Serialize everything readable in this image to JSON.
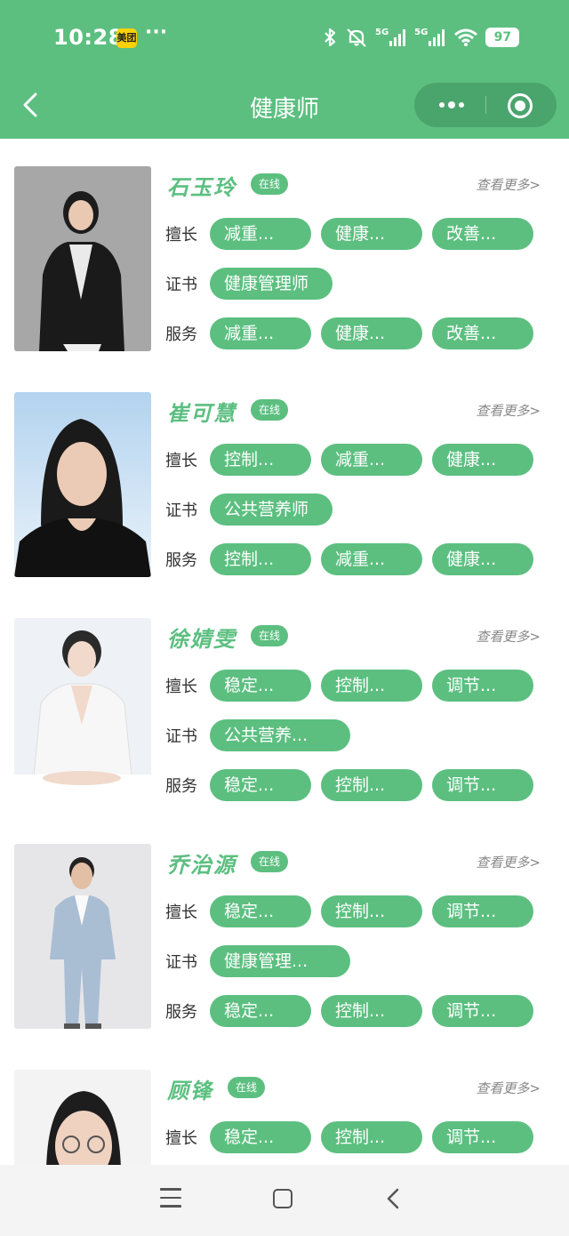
{
  "status_bar": {
    "time": "10:28",
    "app_badge": "美团",
    "more_dots": "···",
    "network1": "5G",
    "network2": "5G",
    "battery": "97"
  },
  "nav": {
    "title": "健康师"
  },
  "labels": {
    "expertise": "擅长",
    "certificate": "证书",
    "service": "服务",
    "online": "在线",
    "see_more": "查看更多>"
  },
  "experts": [
    {
      "name": "石玉玲",
      "expertise": [
        "减重...",
        "健康...",
        "改善..."
      ],
      "certificate": "健康管理师",
      "services": [
        "减重...",
        "健康...",
        "改善..."
      ]
    },
    {
      "name": "崔可慧",
      "expertise": [
        "控制...",
        "减重...",
        "健康..."
      ],
      "certificate": "公共营养师",
      "services": [
        "控制...",
        "减重...",
        "健康..."
      ]
    },
    {
      "name": "徐婧雯",
      "expertise": [
        "稳定...",
        "控制...",
        "调节..."
      ],
      "certificate": "公共营养...",
      "services": [
        "稳定...",
        "控制...",
        "调节..."
      ]
    },
    {
      "name": "乔治源",
      "expertise": [
        "稳定...",
        "控制...",
        "调节..."
      ],
      "certificate": "健康管理...",
      "services": [
        "稳定...",
        "控制...",
        "调节..."
      ]
    },
    {
      "name": "顾锋",
      "expertise": [
        "稳定...",
        "控制...",
        "调节..."
      ]
    }
  ],
  "colors": {
    "primary": "#5cbf80",
    "capsule": "#4aa56c"
  }
}
